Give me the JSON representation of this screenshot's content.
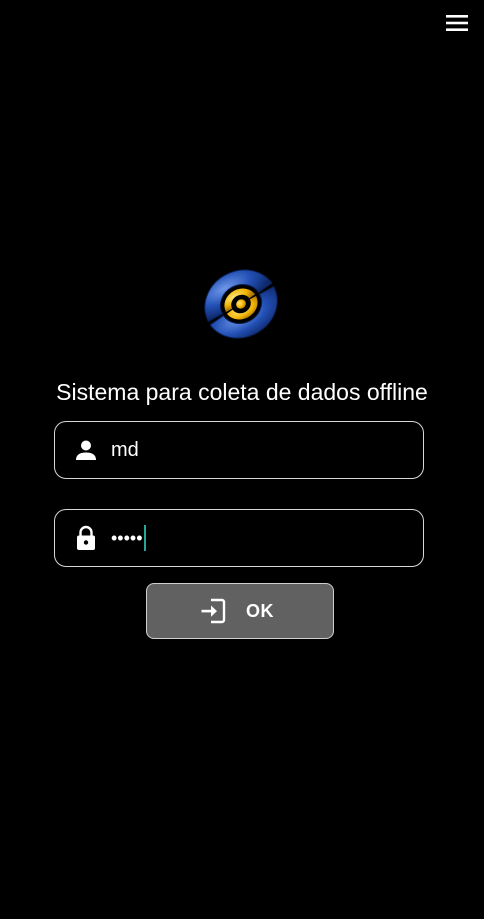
{
  "header": {
    "menu_icon": "hamburger-menu-icon"
  },
  "logo": {
    "icon": "app-logo",
    "colors": {
      "ring": "#1f4fb0",
      "ring_light": "#5b86e0",
      "center": "#f2b400"
    }
  },
  "login": {
    "title": "Sistema para coleta de dados offline",
    "username": {
      "icon": "user-icon",
      "value": "md"
    },
    "password": {
      "icon": "lock-icon",
      "masked_value": "•••••"
    },
    "submit": {
      "icon": "login-icon",
      "label": "OK"
    }
  },
  "theme": {
    "background": "#000000",
    "text": "#ffffff",
    "button_bg": "#616161",
    "caret": "#26a69a"
  }
}
